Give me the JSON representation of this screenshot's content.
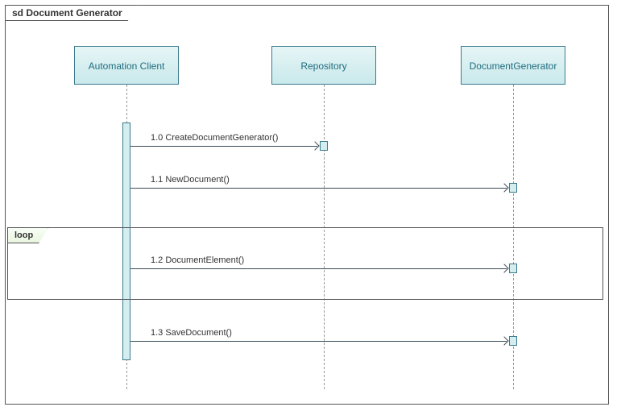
{
  "frame": {
    "title": "sd Document Generator"
  },
  "participants": {
    "p1": "Automation Client",
    "p2": "Repository",
    "p3": "DocumentGenerator"
  },
  "messages": {
    "m1": "1.0 CreateDocumentGenerator()",
    "m2": "1.1 NewDocument()",
    "m3": "1.2 DocumentElement()",
    "m4": "1.3 SaveDocument()"
  },
  "fragment": {
    "label": "loop"
  }
}
